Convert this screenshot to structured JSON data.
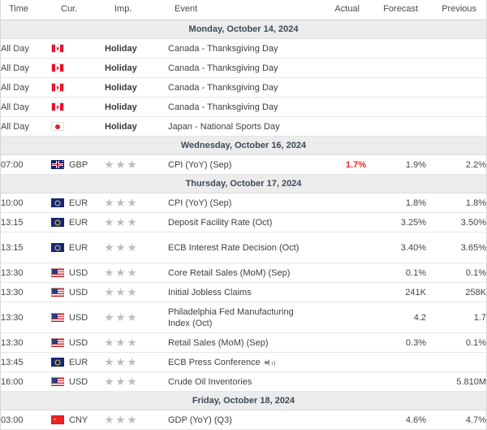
{
  "header": {
    "columns": {
      "time": "Time",
      "currency": "Cur.",
      "importance": "Imp.",
      "event": "Event",
      "actual": "Actual",
      "forecast": "Forecast",
      "previous": "Previous"
    }
  },
  "colors": {
    "negative": "#e8252a",
    "date_band": "#ececec",
    "star": "#bdbdbd",
    "text": "#3f3f3f"
  },
  "sections": [
    {
      "date": "Monday, October 14, 2024",
      "rows": [
        {
          "time": "All Day",
          "flag": "flag-ca",
          "currency": "",
          "importance_text": "Holiday",
          "stars": 0,
          "event": "Canada - Thanksgiving Day",
          "has_audio": false,
          "actual": "",
          "forecast": "",
          "previous": "",
          "actual_state": "none"
        },
        {
          "time": "All Day",
          "flag": "flag-ca",
          "currency": "",
          "importance_text": "Holiday",
          "stars": 0,
          "event": "Canada - Thanksgiving Day",
          "has_audio": false,
          "actual": "",
          "forecast": "",
          "previous": "",
          "actual_state": "none"
        },
        {
          "time": "All Day",
          "flag": "flag-ca",
          "currency": "",
          "importance_text": "Holiday",
          "stars": 0,
          "event": "Canada - Thanksgiving Day",
          "has_audio": false,
          "actual": "",
          "forecast": "",
          "previous": "",
          "actual_state": "none"
        },
        {
          "time": "All Day",
          "flag": "flag-ca",
          "currency": "",
          "importance_text": "Holiday",
          "stars": 0,
          "event": "Canada - Thanksgiving Day",
          "has_audio": false,
          "actual": "",
          "forecast": "",
          "previous": "",
          "actual_state": "none"
        },
        {
          "time": "All Day",
          "flag": "flag-jp",
          "currency": "",
          "importance_text": "Holiday",
          "stars": 0,
          "event": "Japan - National Sports Day",
          "has_audio": false,
          "actual": "",
          "forecast": "",
          "previous": "",
          "actual_state": "none"
        }
      ]
    },
    {
      "date": "Wednesday, October 16, 2024",
      "rows": [
        {
          "time": "07:00",
          "flag": "flag-gb",
          "currency": "GBP",
          "importance_text": "",
          "stars": 3,
          "event": "CPI (YoY) (Sep)",
          "has_audio": false,
          "actual": "1.7%",
          "forecast": "1.9%",
          "previous": "2.2%",
          "actual_state": "negative"
        }
      ]
    },
    {
      "date": "Thursday, October 17, 2024",
      "rows": [
        {
          "time": "10:00",
          "flag": "flag-eu",
          "currency": "EUR",
          "importance_text": "",
          "stars": 3,
          "event": "CPI (YoY) (Sep)",
          "has_audio": false,
          "actual": "",
          "forecast": "1.8%",
          "previous": "1.8%",
          "actual_state": "none"
        },
        {
          "time": "13:15",
          "flag": "flag-eu",
          "currency": "EUR",
          "importance_text": "",
          "stars": 3,
          "event": "Deposit Facility Rate (Oct)",
          "has_audio": false,
          "actual": "",
          "forecast": "3.25%",
          "previous": "3.50%",
          "actual_state": "none"
        },
        {
          "time": "13:15",
          "flag": "flag-eu",
          "currency": "EUR",
          "importance_text": "",
          "stars": 3,
          "event": "ECB Interest Rate Decision (Oct)",
          "has_audio": false,
          "actual": "",
          "forecast": "3.40%",
          "previous": "3.65%",
          "actual_state": "none",
          "tall": true
        },
        {
          "time": "13:30",
          "flag": "flag-us",
          "currency": "USD",
          "importance_text": "",
          "stars": 3,
          "event": "Core Retail Sales (MoM) (Sep)",
          "has_audio": false,
          "actual": "",
          "forecast": "0.1%",
          "previous": "0.1%",
          "actual_state": "none"
        },
        {
          "time": "13:30",
          "flag": "flag-us",
          "currency": "USD",
          "importance_text": "",
          "stars": 3,
          "event": "Initial Jobless Claims",
          "has_audio": false,
          "actual": "",
          "forecast": "241K",
          "previous": "258K",
          "actual_state": "none"
        },
        {
          "time": "13:30",
          "flag": "flag-us",
          "currency": "USD",
          "importance_text": "",
          "stars": 3,
          "event": "Philadelphia Fed Manufacturing Index (Oct)",
          "has_audio": false,
          "actual": "",
          "forecast": "4.2",
          "previous": "1.7",
          "actual_state": "none",
          "tall": true
        },
        {
          "time": "13:30",
          "flag": "flag-us",
          "currency": "USD",
          "importance_text": "",
          "stars": 3,
          "event": "Retail Sales (MoM) (Sep)",
          "has_audio": false,
          "actual": "",
          "forecast": "0.3%",
          "previous": "0.1%",
          "actual_state": "none"
        },
        {
          "time": "13:45",
          "flag": "flag-eu",
          "currency": "EUR",
          "importance_text": "",
          "stars": 3,
          "event": "ECB Press Conference",
          "has_audio": true,
          "actual": "",
          "forecast": "",
          "previous": "",
          "actual_state": "none"
        },
        {
          "time": "16:00",
          "flag": "flag-us",
          "currency": "USD",
          "importance_text": "",
          "stars": 3,
          "event": "Crude Oil Inventories",
          "has_audio": false,
          "actual": "",
          "forecast": "",
          "previous": "5.810M",
          "actual_state": "none"
        }
      ]
    },
    {
      "date": "Friday, October 18, 2024",
      "rows": [
        {
          "time": "03:00",
          "flag": "flag-cn",
          "currency": "CNY",
          "importance_text": "",
          "stars": 3,
          "event": "GDP (YoY) (Q3)",
          "has_audio": false,
          "actual": "",
          "forecast": "4.6%",
          "previous": "4.7%",
          "actual_state": "none"
        }
      ]
    }
  ]
}
